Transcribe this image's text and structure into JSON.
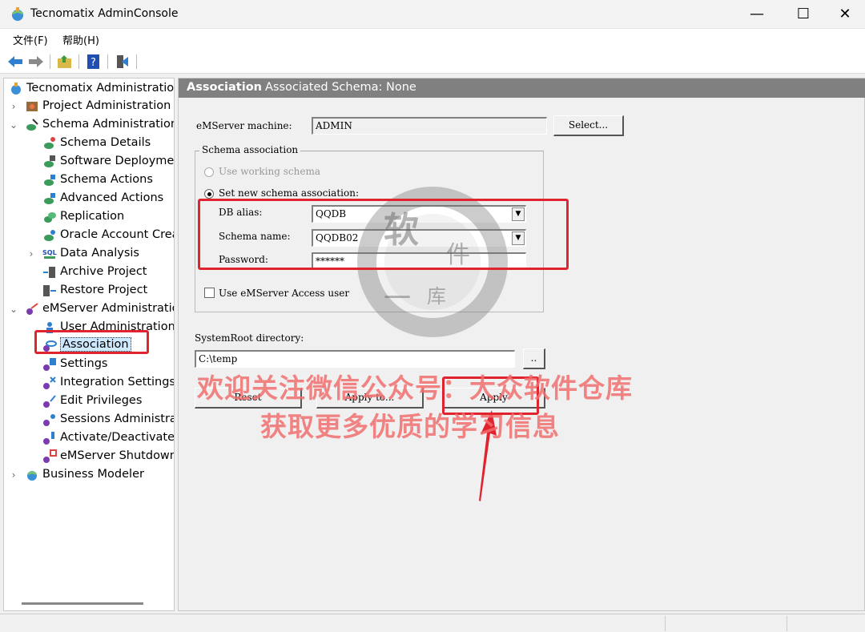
{
  "window": {
    "title": "Tecnomatix AdminConsole",
    "min": "—",
    "max": "☐",
    "close": "✕"
  },
  "menu": [
    {
      "label": "文件(F)"
    },
    {
      "label": "帮助(H)"
    }
  ],
  "tree": {
    "root": "Tecnomatix Administration",
    "items": [
      {
        "label": "Project Administration"
      },
      {
        "label": "Schema Administration"
      },
      {
        "label": "Schema Details"
      },
      {
        "label": "Software Deploymen"
      },
      {
        "label": "Schema Actions"
      },
      {
        "label": "Advanced Actions"
      },
      {
        "label": "Replication"
      },
      {
        "label": "Oracle Account Creat"
      },
      {
        "label": "Data Analysis"
      },
      {
        "label": "Archive Project"
      },
      {
        "label": "Restore Project"
      },
      {
        "label": "eMServer Administratio"
      },
      {
        "label": "User Administration"
      },
      {
        "label": "Association"
      },
      {
        "label": "Settings"
      },
      {
        "label": "Integration Settings"
      },
      {
        "label": "Edit Privileges"
      },
      {
        "label": "Sessions Administrat"
      },
      {
        "label": "Activate/Deactivate L"
      },
      {
        "label": "eMServer Shutdown"
      },
      {
        "label": "Business Modeler"
      }
    ]
  },
  "panel": {
    "title": "Association",
    "subtitle": "Associated Schema: None",
    "emserver_label": "eMServer machine:",
    "emserver_value": "ADMIN",
    "select_button": "Select...",
    "group_title": "Schema association",
    "use_working": "Use working schema",
    "set_new": "Set new schema association:",
    "db_alias_label": "DB alias:",
    "db_alias_value": "QQDB",
    "schema_name_label": "Schema name:",
    "schema_name_value": "QQDB02",
    "password_label": "Password:",
    "password_value": "******",
    "use_emserver_access": "Use eMServer Access user",
    "systemroot_label": "SystemRoot directory:",
    "systemroot_value": "C:\\temp",
    "browse_button": "..",
    "reset_button": "Reset",
    "apply_to_button": "Apply to...",
    "apply_button": "Apply"
  },
  "overlay": {
    "line1": "欢迎关注微信公众号：大众软件仓库",
    "line2": "获取更多优质的学习信息"
  },
  "colors": {
    "accent_red": "#e0242f",
    "header_gray": "#808080",
    "selected_bg": "#cde8ff"
  }
}
